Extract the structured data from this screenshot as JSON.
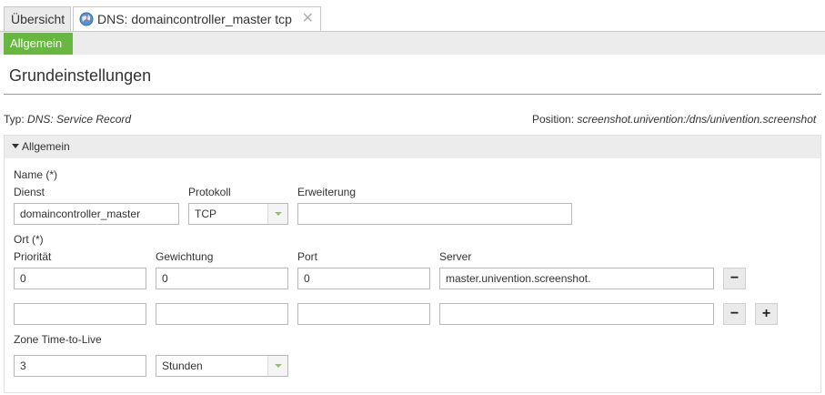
{
  "tabs": {
    "overview": "Übersicht",
    "dns": "DNS: domaincontroller_master tcp",
    "close": "✕"
  },
  "subtabs": {
    "general": "Allgemein"
  },
  "heading": "Grundeinstellungen",
  "type": {
    "label": "Typ:",
    "value": "DNS: Service Record"
  },
  "position": {
    "label": "Position:",
    "value": "screenshot.univention:/dns/univention.screenshot"
  },
  "section": {
    "title": "Allgemein"
  },
  "name": {
    "label": "Name (*)",
    "dienst_label": "Dienst",
    "dienst_value": "domaincontroller_master",
    "protokoll_label": "Protokoll",
    "protokoll_value": "TCP",
    "erweiterung_label": "Erweiterung",
    "erweiterung_value": ""
  },
  "ort": {
    "label": "Ort (*)",
    "prio_label": "Priorität",
    "gewicht_label": "Gewichtung",
    "port_label": "Port",
    "server_label": "Server",
    "rows": [
      {
        "prio": "0",
        "gewicht": "0",
        "port": "0",
        "server": "master.univention.screenshot."
      },
      {
        "prio": "",
        "gewicht": "",
        "port": "",
        "server": ""
      }
    ],
    "remove_symbol": "−",
    "add_symbol": "+"
  },
  "ttl": {
    "label": "Zone Time-to-Live",
    "value": "3",
    "unit": "Stunden"
  }
}
